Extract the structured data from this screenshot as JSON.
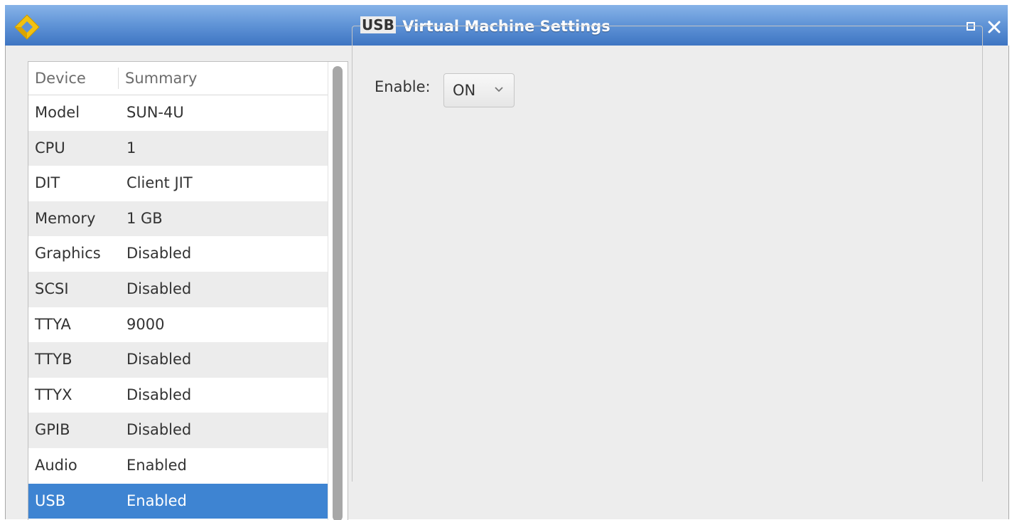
{
  "window": {
    "title": "Virtual Machine Settings"
  },
  "icons": {
    "app": "app-logo-icon",
    "maximize": "maximize-icon",
    "close": "close-icon",
    "dropdown": "chevron-down-icon"
  },
  "colors": {
    "titlebar": "#5f93d6",
    "selection": "#3e84d2",
    "logo": "#f3c10f"
  },
  "device_list": {
    "columns": [
      "Device",
      "Summary"
    ],
    "rows": [
      {
        "device": "Model",
        "summary": "SUN-4U"
      },
      {
        "device": "CPU",
        "summary": "1"
      },
      {
        "device": "DIT",
        "summary": "Client JIT"
      },
      {
        "device": "Memory",
        "summary": "1 GB"
      },
      {
        "device": "Graphics",
        "summary": "Disabled"
      },
      {
        "device": "SCSI",
        "summary": "Disabled"
      },
      {
        "device": "TTYA",
        "summary": "9000"
      },
      {
        "device": "TTYB",
        "summary": "Disabled"
      },
      {
        "device": "TTYX",
        "summary": "Disabled"
      },
      {
        "device": "GPIB",
        "summary": "Disabled"
      },
      {
        "device": "Audio",
        "summary": "Enabled"
      },
      {
        "device": "USB",
        "summary": "Enabled"
      }
    ],
    "selected": "USB"
  },
  "usb_panel": {
    "title": "USB",
    "enable_label": "Enable:",
    "enable_value": "ON"
  }
}
